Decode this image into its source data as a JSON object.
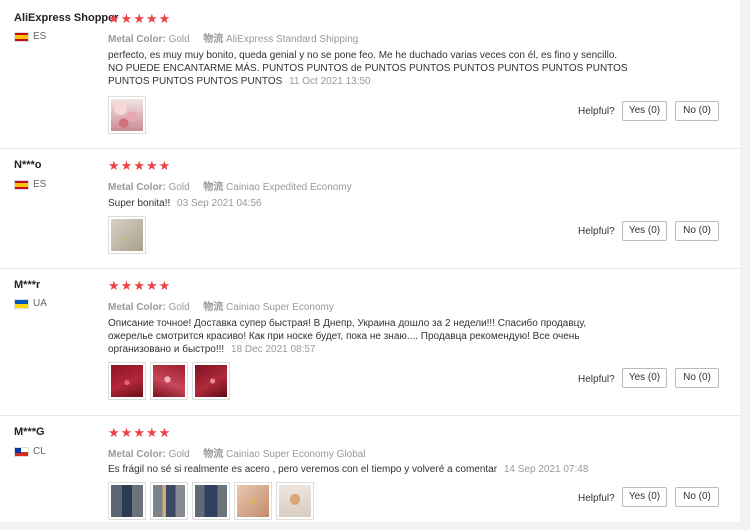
{
  "reviews": [
    {
      "user": "AliExpress Shopper",
      "country_code": "ES",
      "rating": 5,
      "color_label": "Metal Color:",
      "color_value": "Gold",
      "shipping_label": "物流",
      "shipping_value": "AliExpress Standard Shipping",
      "text": "perfecto, es muy muy bonito, queda genial y no se pone feo. Me he duchado varias veces con él, es fino y sencillo. NO PUEDE ENCANTARME MÁS. PUNTOS PUNTOS de PUNTOS PUNTOS PUNTOS PUNTOS PUNTOS PUNTOS PUNTOS PUNTOS PUNTOS PUNTOS",
      "date": "11 Oct 2021 13:50",
      "photos": [
        "floral-phone-case"
      ],
      "helpful": "Helpful?",
      "yes": "Yes (0)",
      "no": "No (0)"
    },
    {
      "user": "N***o",
      "country_code": "ES",
      "rating": 5,
      "color_label": "Metal Color:",
      "color_value": "Gold",
      "shipping_label": "物流",
      "shipping_value": "Cainiao Expedited Economy",
      "text": "Super bonita!!",
      "date": "03 Sep 2021 04:56",
      "photos": [
        "gold-necklace"
      ],
      "helpful": "Helpful?",
      "yes": "Yes (0)",
      "no": "No (0)"
    },
    {
      "user": "M***r",
      "country_code": "UA",
      "rating": 5,
      "color_label": "Metal Color:",
      "color_value": "Gold",
      "shipping_label": "物流",
      "shipping_value": "Cainiao Super Economy",
      "text": "Описание точное! Доставка супер быстрая! В Днепр, Украина дошло за 2 недели!!! Спасибо продавцу, ожерелье смотрится красиво! Как при носке будет, пока не знаю.... Продавца рекомендую! Все очень организовано и быстро!!!",
      "date": "18 Dec 2021 08:57",
      "photos": [
        "red-box-1",
        "red-box-2",
        "red-box-3"
      ],
      "helpful": "Helpful?",
      "yes": "Yes (0)",
      "no": "No (0)"
    },
    {
      "user": "M***G",
      "country_code": "CL",
      "rating": 5,
      "color_label": "Metal Color:",
      "color_value": "Gold",
      "shipping_label": "物流",
      "shipping_value": "Cainiao Super Economy Global",
      "text": "Es frágil no sé si realmente es acero , pero veremos con el tiempo y volveré a comentar",
      "date": "14 Sep 2021 07:48",
      "photos": [
        "dark-package-1",
        "dark-package-2",
        "dark-package-3",
        "pendant-closeup",
        "necklace-worn"
      ],
      "helpful": "Helpful?",
      "yes": "Yes (0)",
      "no": "No (0)"
    }
  ],
  "colors": {
    "star": "#ef4047",
    "muted": "#999999",
    "border": "#bbbbbb"
  }
}
